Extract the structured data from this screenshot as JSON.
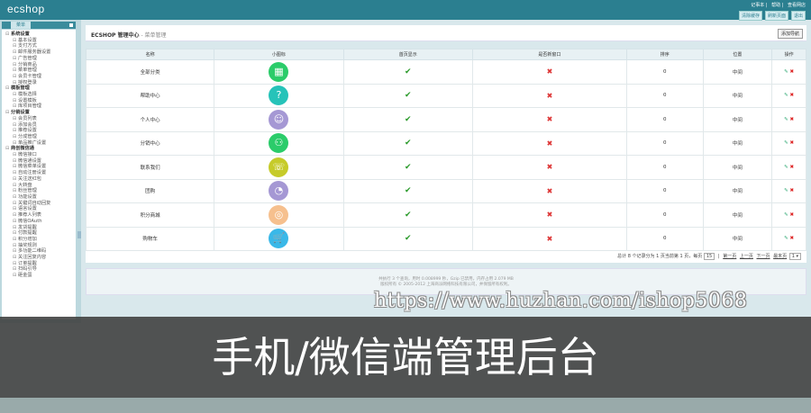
{
  "header": {
    "logo": "ecshop",
    "links": [
      "记事本",
      "帮助",
      "查看网店"
    ],
    "buttons": [
      "清除缓存",
      "刷新页面",
      "退出"
    ]
  },
  "sidebar": {
    "tab": "菜单",
    "groups": [
      {
        "label": "系统设置",
        "items": [
          "基本设置",
          "支付方式",
          "邮件服务器设置",
          "广告管理",
          "分销商品",
          "菜单管理",
          "会员卡管理",
          "授权登录"
        ]
      },
      {
        "label": "模板管理",
        "items": [
          "模板选择",
          "设置模板",
          "库项目管理"
        ]
      },
      {
        "label": "分销设置",
        "items": [
          "会员列表",
          "添加会员",
          "推荐设置",
          "分成管理",
          "单品推广设置"
        ]
      },
      {
        "label": "商创微信通",
        "items": [
          "微信接口",
          "微信通设置",
          "微信菜单设置",
          "自动注册设置",
          "关注送红包",
          "大转盘",
          "粉丝管理",
          "功能设置",
          "关键词自动回复",
          "语言设置",
          "推荐人列表",
          "微信OAuth",
          "发货提醒",
          "付款提醒",
          "积分增加",
          "抽奖规则",
          "多功能二维码",
          "关注回复内容",
          "订单提醒",
          "扫码引导",
          "砸金蛋"
        ]
      }
    ]
  },
  "main": {
    "title": "ECSHOP 管理中心",
    "subtitle": " - 菜单管理",
    "add_button": "添加导航",
    "columns": [
      "名称",
      "小图标",
      "首页显示",
      "是否新窗口",
      "排序",
      "位置",
      "操作"
    ],
    "rows": [
      {
        "name": "全部分类",
        "icon": "grid-icon",
        "glyph": "▦",
        "color": "#2bcc6a",
        "show": "✔",
        "newwin": "✖",
        "sort": "0",
        "pos": "中间"
      },
      {
        "name": "帮助中心",
        "icon": "question-icon",
        "glyph": "?",
        "color": "#26c3b9",
        "show": "✔",
        "newwin": "✖",
        "sort": "0",
        "pos": "中间"
      },
      {
        "name": "个人中心",
        "icon": "user-icon",
        "glyph": "☺",
        "color": "#a598d4",
        "show": "✔",
        "newwin": "✖",
        "sort": "0",
        "pos": "中间"
      },
      {
        "name": "分销中心",
        "icon": "network-icon",
        "glyph": "⚇",
        "color": "#2bcc6a",
        "show": "✔",
        "newwin": "✖",
        "sort": "0",
        "pos": "中间"
      },
      {
        "name": "联系我们",
        "icon": "headset-icon",
        "glyph": "☏",
        "color": "#c6cb2a",
        "show": "✔",
        "newwin": "✖",
        "sort": "0",
        "pos": "中间"
      },
      {
        "name": "团购",
        "icon": "pie-icon",
        "glyph": "◔",
        "color": "#a598d4",
        "show": "✔",
        "newwin": "✖",
        "sort": "0",
        "pos": "中间"
      },
      {
        "name": "积分商城",
        "icon": "points-icon",
        "glyph": "◎",
        "color": "#f6c08e",
        "show": "✔",
        "newwin": "✖",
        "sort": "0",
        "pos": "中间"
      },
      {
        "name": "购物车",
        "icon": "cart-icon",
        "glyph": "🛒",
        "color": "#3ab8e8",
        "show": "✔",
        "newwin": "✖",
        "sort": "0",
        "pos": "中间"
      }
    ],
    "pager": {
      "summary": "总计 8 个记录分为 1 页当前第 1 页，每页",
      "per_page": "15",
      "first": "第一页",
      "prev": "上一页",
      "next": "下一页",
      "last": "最末页",
      "page": "1 ▾"
    },
    "footer": [
      "共执行 3 个查询，用时 0.008999 秒，Gzip 已禁用，内存占用 2.079 MB",
      "版权所有 © 2005-2012 上海商派网络科技有限公司，并保留所有权利。"
    ]
  },
  "watermark": "https://www.huzhan.com/ishop5068",
  "banner": "手机/微信端管理后台"
}
